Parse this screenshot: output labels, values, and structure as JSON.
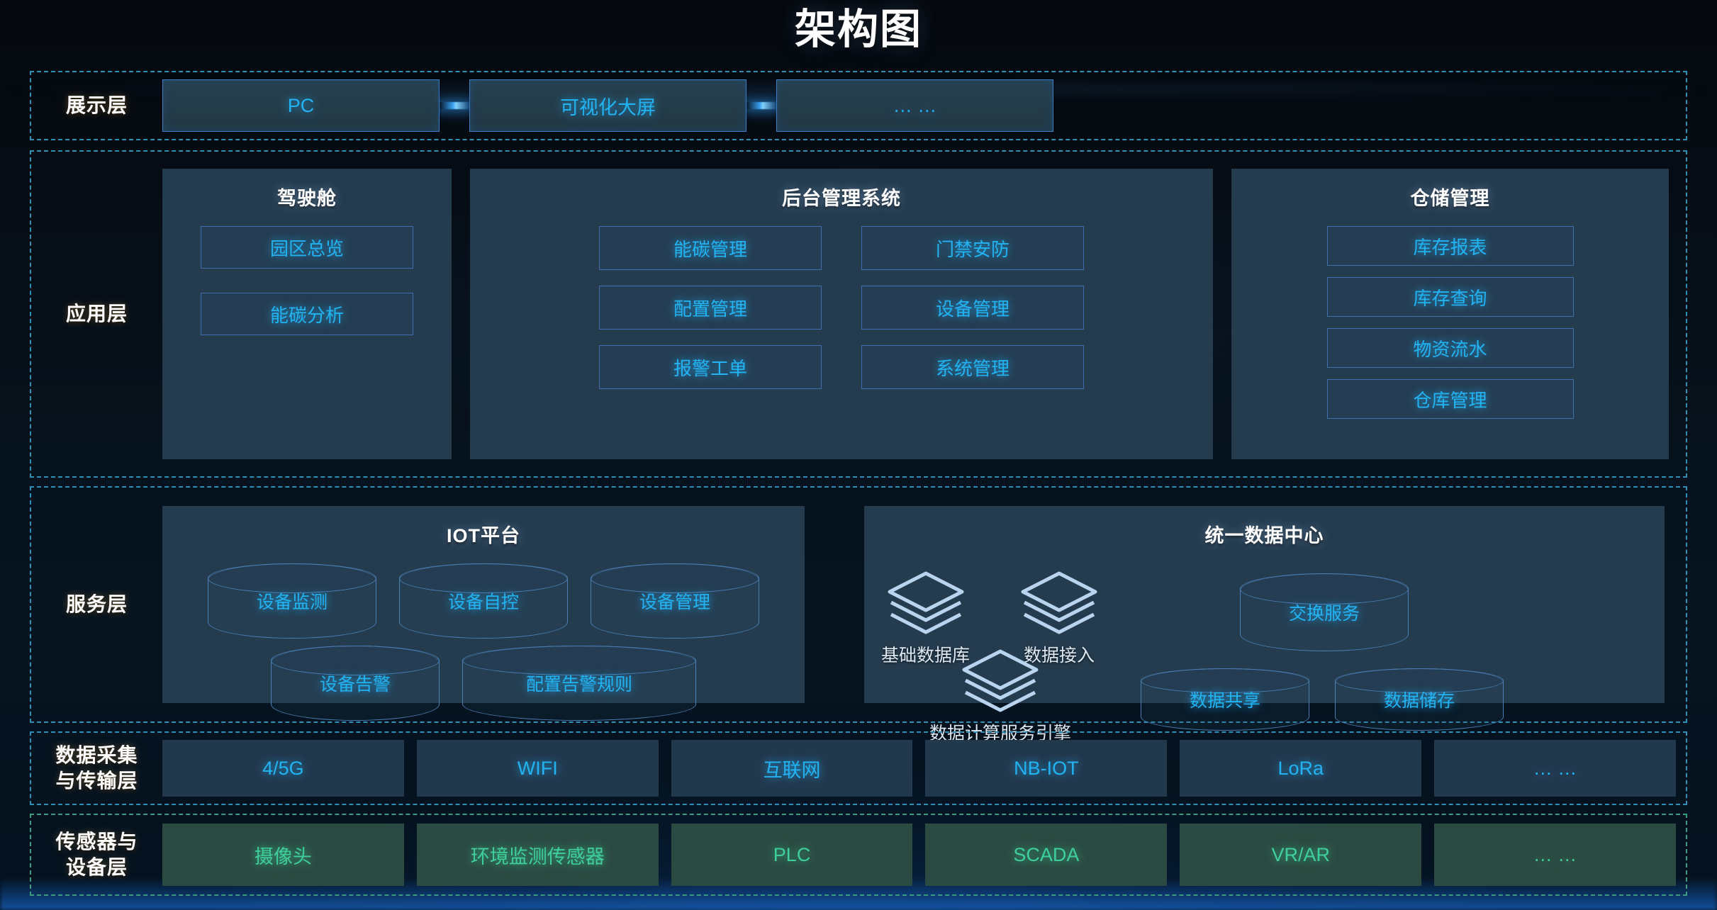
{
  "page": {
    "title": "架构图"
  },
  "colors": {
    "accent_blue": "#22b3f3",
    "accent_green": "#3ecf9a",
    "panel_bg": "#253c4f",
    "tile_blue_bg": "#22384d",
    "tile_green_bg": "#2b4a42",
    "layer_border_blue": "#2f8fb5",
    "layer_border_green": "#3a9c7d",
    "chip_border": "#3f6fae",
    "cylinder_stroke": "#4a7fb5"
  },
  "layers": {
    "presentation": {
      "label": "展示层",
      "boxes": [
        {
          "label": "PC"
        },
        {
          "label": "可视化大屏"
        },
        {
          "label": "… …"
        }
      ]
    },
    "application": {
      "label": "应用层",
      "panels": [
        {
          "title": "驾驶舱",
          "items": [
            "园区总览",
            "能碳分析"
          ]
        },
        {
          "title": "后台管理系统",
          "items": [
            "能碳管理",
            "门禁安防",
            "配置管理",
            "设备管理",
            "报警工单",
            "系统管理"
          ]
        },
        {
          "title": "仓储管理",
          "items": [
            "库存报表",
            "库存查询",
            "物资流水",
            "仓库管理"
          ]
        }
      ]
    },
    "service": {
      "label": "服务层",
      "iot": {
        "title": "IOT平台",
        "row1": [
          "设备监测",
          "设备自控",
          "设备管理"
        ],
        "row2": [
          "设备告警",
          "配置告警规则"
        ]
      },
      "datacenter": {
        "title": "统一数据中心",
        "stacks": [
          {
            "label": "基础数据库",
            "icon": "layers-stack-icon"
          },
          {
            "label": "数据接入",
            "icon": "layers-stack-icon"
          },
          {
            "label": "数据计算服务引擎",
            "icon": "layers-stack-icon"
          }
        ],
        "cylinders": [
          "交换服务",
          "数据共享",
          "数据储存"
        ]
      }
    },
    "collection": {
      "label": "数据采集\n与传输层",
      "label_line1": "数据采集",
      "label_line2": "与传输层",
      "tiles": [
        "4/5G",
        "WIFI",
        "互联网",
        "NB-IOT",
        "LoRa",
        "… …"
      ]
    },
    "sensor": {
      "label_line1": "传感器与",
      "label_line2": "设备层",
      "tiles": [
        "摄像头",
        "环境监测传感器",
        "PLC",
        "SCADA",
        "VR/AR",
        "… …"
      ]
    }
  }
}
